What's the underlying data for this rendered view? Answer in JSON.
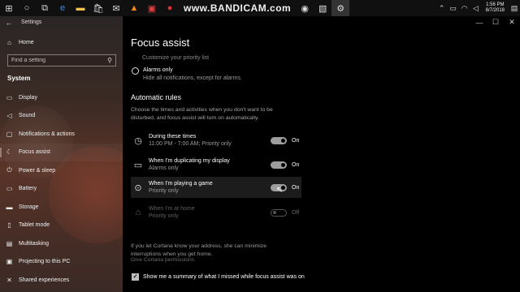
{
  "taskbar": {
    "icons": [
      "start-icon",
      "search-circle-icon",
      "task-view-icon",
      "edge-icon",
      "file-explorer-icon",
      "store-icon",
      "mail-icon",
      "vlc-icon",
      "app-icon",
      "record-icon"
    ],
    "bandicam_watermark": "www.BANDICAM.com",
    "clock_time": "1:56 PM",
    "clock_date": "8/7/2018"
  },
  "window": {
    "title": "Settings",
    "minimize": "—",
    "maximize": "☐",
    "close": "✕"
  },
  "sidebar": {
    "home_label": "Home",
    "search_placeholder": "Find a setting",
    "section_heading": "System",
    "items": [
      {
        "label": "Display",
        "icon": "display-icon"
      },
      {
        "label": "Sound",
        "icon": "sound-icon"
      },
      {
        "label": "Notifications & actions",
        "icon": "notifications-icon"
      },
      {
        "label": "Focus assist",
        "icon": "moon-icon"
      },
      {
        "label": "Power & sleep",
        "icon": "power-icon"
      },
      {
        "label": "Battery",
        "icon": "battery-icon"
      },
      {
        "label": "Storage",
        "icon": "storage-icon"
      },
      {
        "label": "Tablet mode",
        "icon": "tablet-icon"
      },
      {
        "label": "Multitasking",
        "icon": "multitasking-icon"
      },
      {
        "label": "Projecting to this PC",
        "icon": "projecting-icon"
      },
      {
        "label": "Shared experiences",
        "icon": "shared-icon"
      }
    ],
    "selected": "Focus assist"
  },
  "main": {
    "title": "Focus assist",
    "cut_text": "Customize your priority list",
    "alarms_only": {
      "label": "Alarms only",
      "description": "Hide all notifications, except for alarms."
    },
    "rules_heading": "Automatic rules",
    "rules_description": "Choose the times and activities when you don't want to be disturbed, and focus assist will turn on automatically.",
    "rules": [
      {
        "name": "During these times",
        "sub": "11:00 PM - 7:00 AM; Priority only",
        "state": "On",
        "icon": "clock-icon"
      },
      {
        "name": "When I'm duplicating my display",
        "sub": "Alarms only",
        "state": "On",
        "icon": "monitor-icon"
      },
      {
        "name": "When I'm playing a game",
        "sub": "Priority only",
        "state": "On",
        "icon": "gamepad-icon"
      },
      {
        "name": "When I'm at home",
        "sub": "Priority only",
        "state": "Off",
        "icon": "home-icon"
      }
    ],
    "cortana_text": "If you let Cortana know your address, she can minimize interruptions when you get home.",
    "cortana_link": "Give Cortana permissions",
    "summary_label": "Show me a summary of what I missed while focus assist was on"
  }
}
